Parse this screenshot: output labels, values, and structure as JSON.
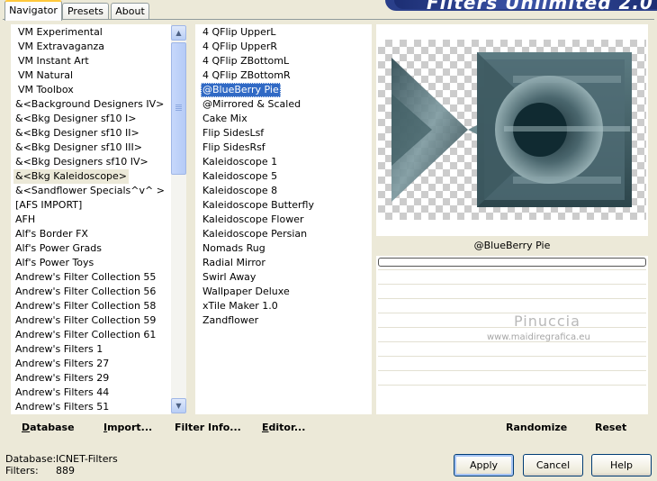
{
  "tabs": [
    "Navigator",
    "Presets",
    "About"
  ],
  "banner_title": "Filters Unlimited 2.0",
  "categories": [
    "VM Experimental",
    "VM Extravaganza",
    "VM Instant Art",
    "VM Natural",
    "VM Toolbox",
    "&<Background Designers IV>",
    "&<Bkg Designer sf10 I>",
    "&<Bkg Designer sf10 II>",
    "&<Bkg Designer sf10 III>",
    "&<Bkg Designers sf10 IV>",
    "&<Bkg Kaleidoscope>",
    "&<Sandflower Specials^v^ >",
    "[AFS IMPORT]",
    "AFH",
    "Alf's Border FX",
    "Alf's Power Grads",
    "Alf's Power Toys",
    "Andrew's Filter Collection 55",
    "Andrew's Filter Collection 56",
    "Andrew's Filter Collection 58",
    "Andrew's Filter Collection 59",
    "Andrew's Filter Collection 61",
    "Andrew's Filters 1",
    "Andrew's Filters 27",
    "Andrew's Filters 29",
    "Andrew's Filters 44",
    "Andrew's Filters 51"
  ],
  "selected_category": "&<Bkg Kaleidoscope>",
  "filters": [
    "4 QFlip UpperL",
    "4 QFlip UpperR",
    "4 QFlip ZBottomL",
    "4 QFlip ZBottomR",
    "@BlueBerry Pie",
    "@Mirrored & Scaled",
    "Cake Mix",
    "Flip SidesLsf",
    "Flip SidesRsf",
    "Kaleidoscope 1",
    "Kaleidoscope 5",
    "Kaleidoscope 8",
    "Kaleidoscope Butterfly",
    "Kaleidoscope Flower",
    "Kaleidoscope Persian",
    "Nomads Rug",
    "Radial Mirror",
    "Swirl Away",
    "Wallpaper Deluxe",
    "xTile Maker 1.0",
    "Zandflower"
  ],
  "selected_filter": "@BlueBerry Pie",
  "preview_filter_name": "@BlueBerry Pie",
  "watermark": {
    "name": "Pinuccia",
    "site": "www.maidiregrafica.eu"
  },
  "bottom_left_buttons": {
    "database": "Database",
    "import": "Import...",
    "filter_info": "Filter Info...",
    "editor": "Editor..."
  },
  "bottom_right_buttons": {
    "randomize": "Randomize",
    "reset": "Reset"
  },
  "status": {
    "database_label": "Database:",
    "database_value": "ICNET-Filters",
    "filters_label": "Filters:",
    "filters_value": "889"
  },
  "dialog_buttons": {
    "apply": "Apply",
    "cancel": "Cancel",
    "help": "Help"
  },
  "colors": {
    "selection": "#316ac5",
    "banner": "#2a3f8a",
    "preview_art": "#4f6c74"
  }
}
